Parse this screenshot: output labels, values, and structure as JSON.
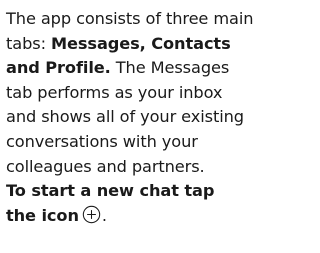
{
  "intro": {
    "line1": "The app consists of three main",
    "line2_prefix": "tabs: ",
    "line2_bold": "Messages, Contacts",
    "line3_bold": "and Profile.",
    "line3_suffix": " The Messages",
    "line4": "tab performs as your inbox",
    "line5": "and shows all of your existing",
    "line6": "conversations with your",
    "line7": "colleagues and partners.",
    "line8_bold": "To start a new chat tap",
    "line9_bold": "the icon",
    "line9_suffix": "."
  },
  "icons": {
    "new_chat": "plus-circle-icon"
  },
  "colors": {
    "text": "#1a1a1a"
  }
}
